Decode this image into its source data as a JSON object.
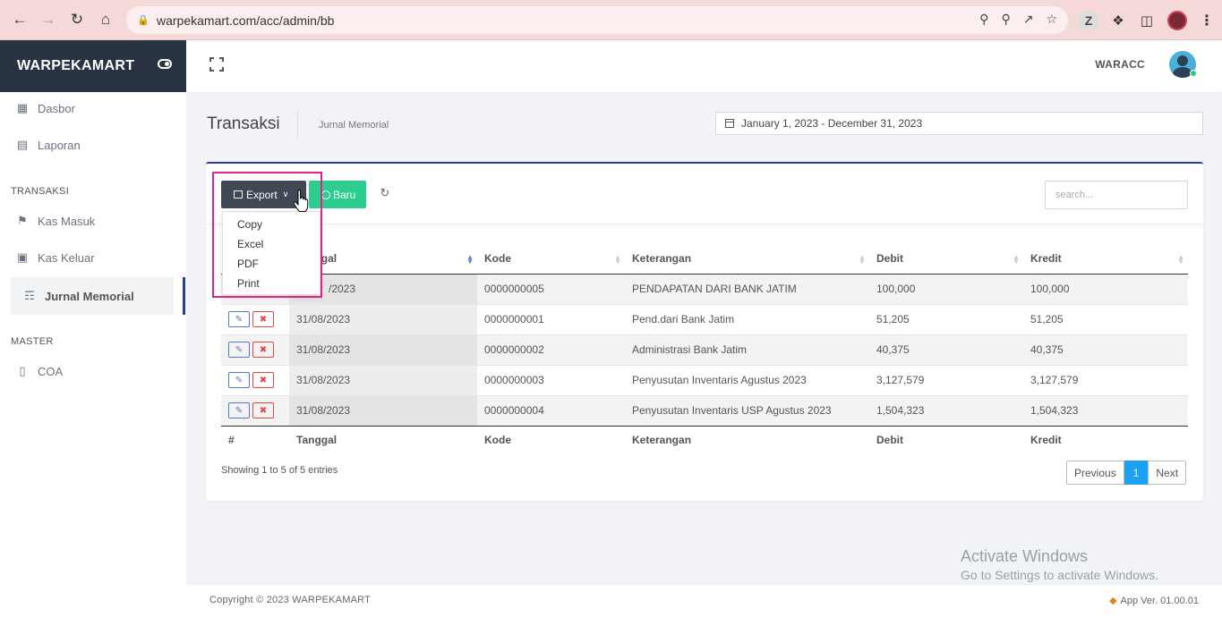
{
  "browser": {
    "url": "warpekamart.com/acc/admin/bb",
    "extension_letter": "Z"
  },
  "sidebar": {
    "brand": "WARPEKAMART",
    "items": [
      {
        "label": "Dasbor",
        "icon": "dashboard-icon"
      },
      {
        "label": "Laporan",
        "icon": "report-icon"
      }
    ],
    "section_transaksi": "TRANSAKSI",
    "transaksi_items": [
      {
        "label": "Kas Masuk",
        "icon": "bank-icon"
      },
      {
        "label": "Kas Keluar",
        "icon": "wallet-icon"
      },
      {
        "label": "Jurnal Memorial",
        "icon": "book-icon",
        "active": true
      }
    ],
    "section_master": "MASTER",
    "master_items": [
      {
        "label": "COA",
        "icon": "ledger-icon"
      }
    ]
  },
  "header": {
    "user_name": "WARACC"
  },
  "page": {
    "title": "Transaksi",
    "subtitle": "Jurnal Memorial",
    "date_range": "January 1, 2023 - December 31, 2023"
  },
  "toolbar": {
    "export_label": "Export",
    "new_label": "Baru",
    "search_placeholder": "search..."
  },
  "export_menu": [
    "Copy",
    "Excel",
    "PDF",
    "Print"
  ],
  "table": {
    "columns": [
      "#",
      "Tanggal",
      "Kode",
      "Keterangan",
      "Debit",
      "Kredit"
    ],
    "rows": [
      {
        "tanggal": "31/08/2023",
        "kode": "0000000005",
        "keterangan": "PENDAPATAN DARI BANK JATIM",
        "debit": "100,000",
        "kredit": "100,000"
      },
      {
        "tanggal": "31/08/2023",
        "kode": "0000000001",
        "keterangan": "Pend.dari Bank Jatim",
        "debit": "51,205",
        "kredit": "51,205"
      },
      {
        "tanggal": "31/08/2023",
        "kode": "0000000002",
        "keterangan": "Administrasi Bank Jatim",
        "debit": "40,375",
        "kredit": "40,375"
      },
      {
        "tanggal": "31/08/2023",
        "kode": "0000000003",
        "keterangan": "Penyusutan Inventaris Agustus 2023",
        "debit": "3,127,579",
        "kredit": "3,127,579"
      },
      {
        "tanggal": "31/08/2023",
        "kode": "0000000004",
        "keterangan": "Penyusutan Inventaris USP Agustus 2023",
        "debit": "1,504,323",
        "kredit": "1,504,323"
      }
    ],
    "first_row_date_visible": "/2023"
  },
  "pagination": {
    "info": "Showing 1 to 5 of 5 entries",
    "previous": "Previous",
    "current": "1",
    "next": "Next"
  },
  "footer": {
    "copyright": "Copyright © 2023 WARPEKAMART",
    "version": "App Ver. 01.00.01"
  },
  "watermark": {
    "line1": "Activate Windows",
    "line2": "Go to Settings to activate Windows."
  },
  "colors": {
    "brand_bg": "#2a3342",
    "accent": "#2c3e8f",
    "new_button": "#2ecc8f",
    "export_button": "#414855",
    "highlight": "#e0238a",
    "page_active": "#1da1f2"
  }
}
